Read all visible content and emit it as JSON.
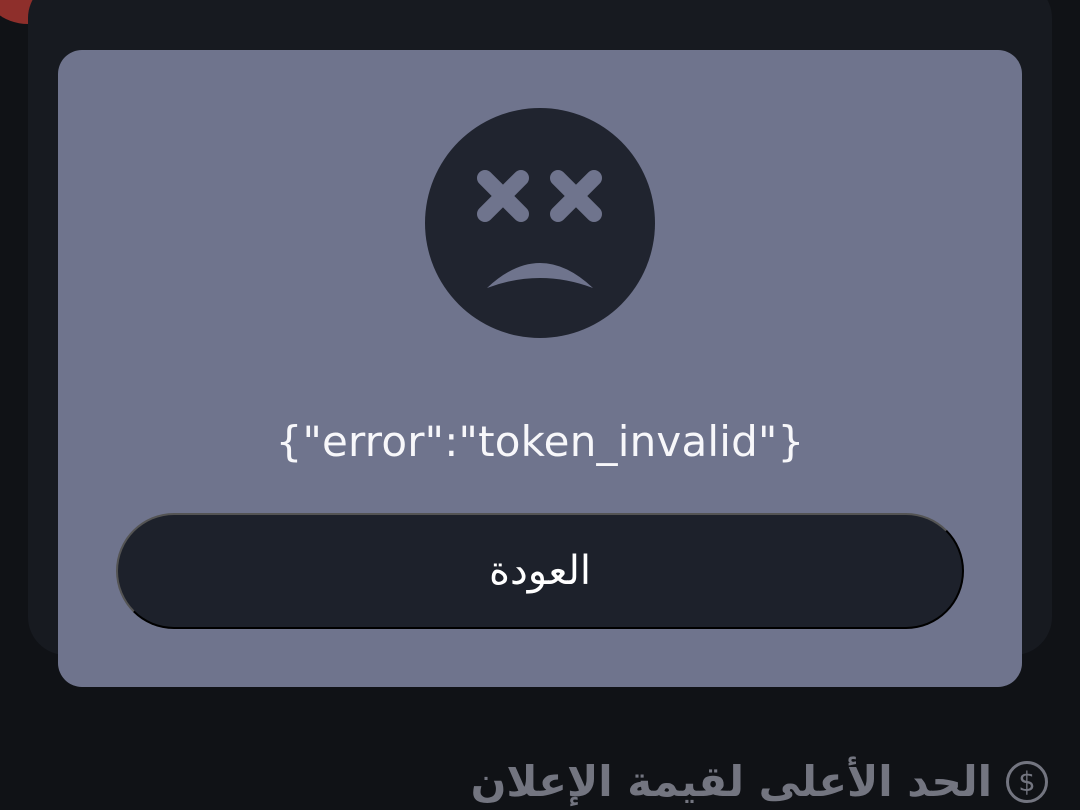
{
  "error_dialog": {
    "message": "{\"error\":\"token_invalid\"}",
    "back_button_label": "العودة",
    "icon": "sad-face-icon"
  },
  "background_section": {
    "label": "الحد الأعلى لقيمة الإعلان",
    "icon_symbol": "$",
    "icon": "dollar-circle-icon"
  },
  "colors": {
    "background": "#101216",
    "modal": "#6f748d",
    "button": "#1d212b",
    "icon_fill": "#20242f",
    "accent_red": "#8e2f2b"
  }
}
